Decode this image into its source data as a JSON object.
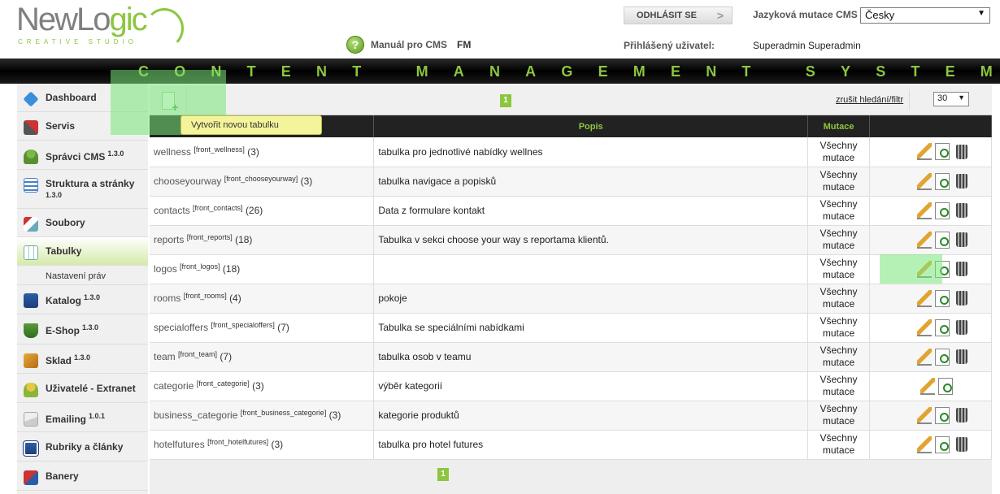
{
  "header": {
    "logo_text_main": "NewLo",
    "logo_text_accent": "gic",
    "logo_subtitle": "CREATIVE STUDIO",
    "manual_label": "Manuál pro CMS",
    "fm_label": "FM",
    "logout_label": "ODHLÁSIT SE",
    "lang_label": "Jazyková mutace CMS",
    "lang_value": "Česky",
    "user_label": "Přihlášený uživatel:",
    "user_value": "Superadmin Superadmin"
  },
  "banner": {
    "text": "CONTENT MANAGEMENT SYSTEM"
  },
  "sidebar": {
    "items": [
      {
        "label": "Dashboard",
        "version": ""
      },
      {
        "label": "Servis",
        "version": ""
      },
      {
        "label": "Správci CMS",
        "version": "1.3.0"
      },
      {
        "label": "Struktura a stránky",
        "version": "1.3.0"
      },
      {
        "label": "Soubory",
        "version": ""
      },
      {
        "label": "Tabulky",
        "version": ""
      },
      {
        "label": "Katalog",
        "version": "1.3.0"
      },
      {
        "label": "E-Shop",
        "version": "1.3.0"
      },
      {
        "label": "Sklad",
        "version": "1.3.0"
      },
      {
        "label": "Uživatelé - Extranet",
        "version": ""
      },
      {
        "label": "Emailing",
        "version": "1.0.1"
      },
      {
        "label": "Rubriky a články",
        "version": ""
      },
      {
        "label": "Banery",
        "version": ""
      }
    ],
    "subitem": "Nastavení práv"
  },
  "toolbar": {
    "tooltip": "Vytvořit novou tabulku",
    "page": "1",
    "cancel_filter": "zrušit hledání/filtr",
    "per_page": "30"
  },
  "table": {
    "headers": [
      "",
      "Popis",
      "Mutace",
      ""
    ],
    "mutace_line1": "Všechny",
    "mutace_line2": "mutace",
    "rows": [
      {
        "name": "wellness",
        "code": "[front_wellness]",
        "count": "(3)",
        "desc": "tabulka pro jednotlivé nabídky wellnes"
      },
      {
        "name": "chooseyourway",
        "code": "[front_chooseyourway]",
        "count": "(3)",
        "desc": "tabulka navigace a popisků"
      },
      {
        "name": "contacts",
        "code": "[front_contacts]",
        "count": "(26)",
        "desc": "Data z formulare kontakt"
      },
      {
        "name": "reports",
        "code": "[front_reports]",
        "count": "(18)",
        "desc": "Tabulka v sekci choose your way s reportama klientů."
      },
      {
        "name": "logos",
        "code": "[front_logos]",
        "count": "(18)",
        "desc": ""
      },
      {
        "name": "rooms",
        "code": "[front_rooms]",
        "count": "(4)",
        "desc": "pokoje"
      },
      {
        "name": "specialoffers",
        "code": "[front_specialoffers]",
        "count": "(7)",
        "desc": "Tabulka se speciálními nabídkami"
      },
      {
        "name": "team",
        "code": "[front_team]",
        "count": "(7)",
        "desc": "tabulka osob v teamu"
      },
      {
        "name": "categorie",
        "code": "[front_categorie]",
        "count": "(3)",
        "desc": "výběr kategorií"
      },
      {
        "name": "business_categorie",
        "code": "[front_business_categorie]",
        "count": "(3)",
        "desc": "kategorie produktů"
      },
      {
        "name": "hotelfutures",
        "code": "[front_hotelfutures]",
        "count": "(3)",
        "desc": "tabulka pro hotel futures"
      }
    ]
  },
  "footer": {
    "page": "1"
  }
}
